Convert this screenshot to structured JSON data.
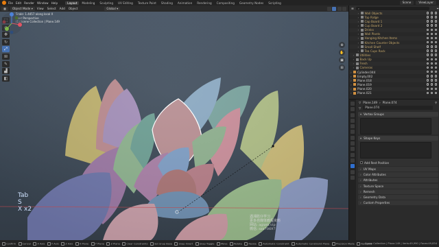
{
  "topbar": {
    "menus": [
      "File",
      "Edit",
      "Render",
      "Window",
      "Help"
    ],
    "workspaces": [
      "Layout",
      "Modeling",
      "Sculpting",
      "UV Editing",
      "Texture Paint",
      "Shading",
      "Animation",
      "Rendering",
      "Compositing",
      "Geometry Nodes",
      "Scripting"
    ],
    "active_workspace": "Layout",
    "scene": "Scene",
    "view_layer": "ViewLayer"
  },
  "viewport_header": {
    "mode": "Object Mode",
    "menus": [
      "View",
      "Select",
      "Add",
      "Object"
    ],
    "transform_orientation": "Global"
  },
  "viewport": {
    "operator_info": "Scale: 1.4457 along local X",
    "view_name": "User Perspective",
    "collection_info": "(1) Scene Collection | Plane.149",
    "key_overlay": [
      "Tab",
      "S",
      "X x2"
    ],
    "watermark_line1": "遇湘胜仔学习",
    "watermark_line2": "更多自媒体教程资料",
    "watermark_line3": "网站: agxen.vip",
    "watermark_line4": "微信: ssn70697"
  },
  "outliner": {
    "search_placeholder": "",
    "rows": [
      {
        "name": "Wall Objects",
        "kind": "collection",
        "indent": 3
      },
      {
        "name": "Top Ridge",
        "kind": "collection",
        "indent": 3
      },
      {
        "name": "Cap Board 1",
        "kind": "collection",
        "indent": 3
      },
      {
        "name": "Cup Board 2",
        "kind": "collection",
        "indent": 3
      },
      {
        "name": "Drinks",
        "kind": "collection",
        "indent": 3
      },
      {
        "name": "Wall Plants",
        "kind": "collection",
        "indent": 3
      },
      {
        "name": "Hanging Kitchen Items",
        "kind": "collection",
        "indent": 3
      },
      {
        "name": "Kitchen Counter Objects",
        "kind": "collection",
        "indent": 3
      },
      {
        "name": "Small Shelf",
        "kind": "collection",
        "indent": 3
      },
      {
        "name": "Tea Cups Rack",
        "kind": "collection",
        "indent": 3
      },
      {
        "name": "Utilities",
        "kind": "collection",
        "indent": 1
      },
      {
        "name": "Back Up",
        "kind": "collection",
        "indent": 1
      },
      {
        "name": "Fresh",
        "kind": "collection",
        "indent": 1
      },
      {
        "name": "Cameras",
        "kind": "collection",
        "indent": 1
      },
      {
        "name": "Cylinder.044",
        "kind": "object",
        "indent": 0
      },
      {
        "name": "Empty.002",
        "kind": "object",
        "indent": 0
      },
      {
        "name": "Plane.018",
        "kind": "object",
        "indent": 0
      },
      {
        "name": "Plane.019",
        "kind": "object",
        "indent": 0
      },
      {
        "name": "Plane.020",
        "kind": "object",
        "indent": 0
      },
      {
        "name": "Plane.021",
        "kind": "object",
        "indent": 0
      }
    ]
  },
  "properties": {
    "breadcrumb": [
      "Plane.149",
      "Plane.074"
    ],
    "data_name": "Plane.074",
    "panels": {
      "vertex_groups": "Vertex Groups",
      "shape_keys": "Shape Keys",
      "add_rest_position": "Add Rest Position"
    },
    "collapsed_panels": [
      "UV Maps",
      "Color Attributes",
      "Attributes",
      "Texture Space",
      "Remesh",
      "Geometry Data",
      "Custom Properties"
    ]
  },
  "statusbar": {
    "items": [
      "Confirm",
      "Cancel",
      "X Axis",
      "Y Axis",
      "Z Axis",
      "X Plane",
      "Y Plane",
      "Z Plane",
      "Clear Constraints",
      "Set Snap Base",
      "Snap Invert",
      "Snap Toggle",
      "Move",
      "Rotate",
      "Resize",
      "Automatic Constraint",
      "Automatic Constraint Plane",
      "Precision Mode",
      "Navigate"
    ],
    "stats": "Scene Collection | Plane.149 | Verts:49,990 | Faces:49,834"
  },
  "colors": {
    "accent": "#4772b3",
    "orange": "#e87d0d",
    "viewport_bg": "#3d4956"
  }
}
